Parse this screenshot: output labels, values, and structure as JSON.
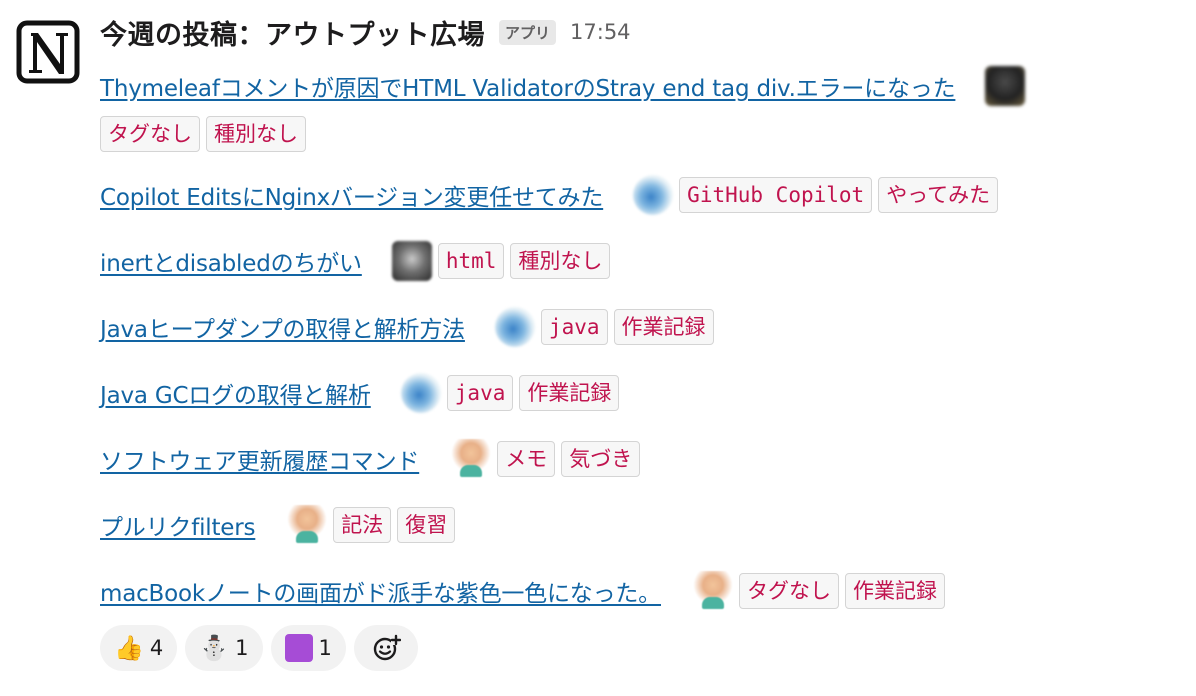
{
  "header": {
    "channel_name": "今週の投稿：アウトプット広場",
    "app_badge": "アプリ",
    "timestamp": "17:54"
  },
  "posts": [
    {
      "title": "Thymeleafコメントが原因でHTML ValidatorのStray end tag div.エラーになった",
      "avatar": "dark",
      "tags": [
        "タグなし",
        "種別なし"
      ]
    },
    {
      "title": "Copilot EditsにNginxバージョン変更任せてみた",
      "avatar": "globe",
      "tags": [
        "GitHub Copilot",
        "やってみた"
      ]
    },
    {
      "title": "inertとdisabledのちがい",
      "avatar": "photo",
      "tags": [
        "html",
        "種別なし"
      ]
    },
    {
      "title": "Javaヒープダンプの取得と解析方法",
      "avatar": "globe",
      "tags": [
        "java",
        "作業記録"
      ]
    },
    {
      "title": "Java GCログの取得と解析",
      "avatar": "globe",
      "tags": [
        "java",
        "作業記録"
      ]
    },
    {
      "title": "ソフトウェア更新履歴コマンド",
      "avatar": "person",
      "tags": [
        "メモ",
        "気づき"
      ]
    },
    {
      "title": "プルリクfilters",
      "avatar": "person",
      "tags": [
        "記法",
        "復習"
      ]
    },
    {
      "title": "macBookノートの画面がド派手な紫色一色になった。",
      "avatar": "person",
      "tags": [
        "タグなし",
        "作業記録"
      ]
    }
  ],
  "reactions": [
    {
      "emoji": "👍",
      "icon": "thumbs-up-icon",
      "count": "4"
    },
    {
      "emoji": "⛄",
      "icon": "snowman-graduate-icon",
      "count": "1"
    },
    {
      "emoji": "",
      "icon": "purple-square-icon",
      "count": "1"
    }
  ],
  "colors": {
    "link": "#1264a3",
    "tag_text": "#c0134e",
    "tag_bg": "#f7f7f7"
  }
}
